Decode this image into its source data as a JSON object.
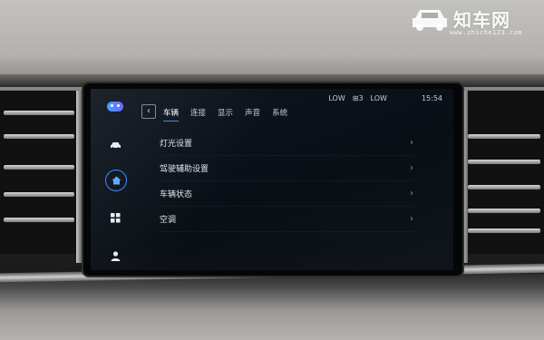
{
  "status_bar": {
    "left_signal": "LOW",
    "indicator": "⊞3",
    "right_signal": "LOW",
    "time": "15:54"
  },
  "tabs": [
    {
      "label": "车辆",
      "active": true
    },
    {
      "label": "连接",
      "active": false
    },
    {
      "label": "显示",
      "active": false
    },
    {
      "label": "声音",
      "active": false
    },
    {
      "label": "系统",
      "active": false
    }
  ],
  "menu": [
    {
      "label": "灯光设置"
    },
    {
      "label": "驾驶辅助设置"
    },
    {
      "label": "车辆状态"
    },
    {
      "label": "空调"
    }
  ],
  "sidebar": {
    "icons": [
      "assistant-icon",
      "car-icon",
      "home-icon",
      "apps-grid-icon",
      "profile-icon"
    ],
    "active_icon": "home-icon"
  },
  "watermark": {
    "brand": "知车网",
    "url": "www.zhiche123.com"
  },
  "colors": {
    "accent": "#2f8cff",
    "screen_bg": "#0c121a",
    "text": "#e2e6ec"
  }
}
